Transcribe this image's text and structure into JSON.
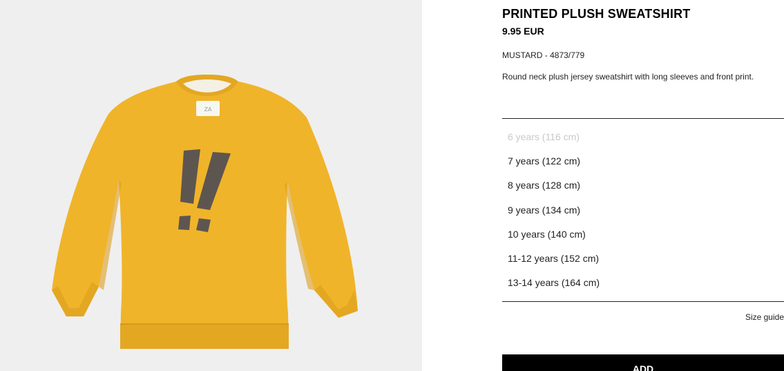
{
  "product": {
    "title": "PRINTED PLUSH SWEATSHIRT",
    "price": "9.95 EUR",
    "reference": "MUSTARD - 4873/779",
    "description": "Round neck plush jersey sweatshirt with long sleeves and front print.",
    "color": "#f0b42a"
  },
  "sizes": [
    {
      "label": "6 years (116 cm)",
      "available": false
    },
    {
      "label": "7 years (122 cm)",
      "available": true
    },
    {
      "label": "8 years (128 cm)",
      "available": true
    },
    {
      "label": "9 years (134 cm)",
      "available": true
    },
    {
      "label": "10 years (140 cm)",
      "available": true
    },
    {
      "label": "11-12 years (152 cm)",
      "available": true
    },
    {
      "label": "13-14 years (164 cm)",
      "available": true
    }
  ],
  "actions": {
    "size_guide_label": "Size guide",
    "add_label": "ADD"
  }
}
